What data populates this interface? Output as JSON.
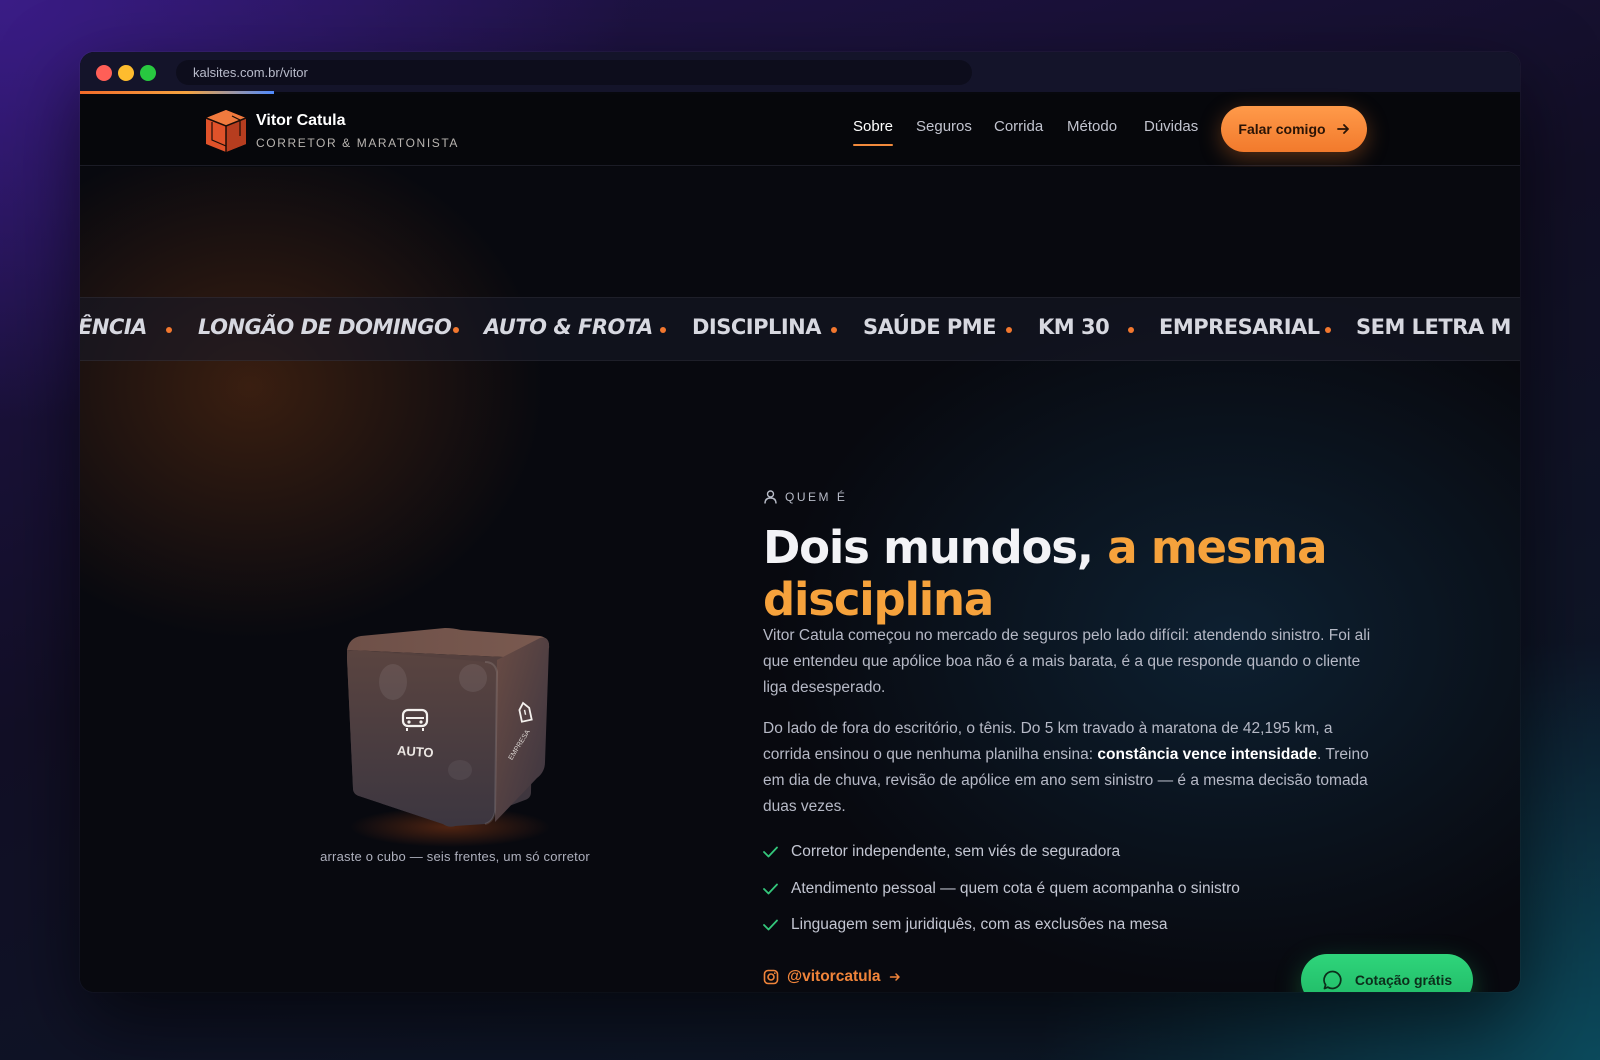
{
  "browser": {
    "url": "kalsites.com.br/vitor"
  },
  "brand": {
    "name": "Vitor Catula",
    "tagline": "CORRETOR & MARATONISTA",
    "accent": "#f27a2c"
  },
  "nav": {
    "items": [
      {
        "label": "Sobre",
        "active": true
      },
      {
        "label": "Seguros",
        "active": false
      },
      {
        "label": "Corrida",
        "active": false
      },
      {
        "label": "Método",
        "active": false
      },
      {
        "label": "Dúvidas",
        "active": false
      }
    ],
    "cta_label": "Falar comigo"
  },
  "marquee": {
    "items": [
      "ÊNCIA",
      "LONGÃO DE DOMINGO",
      "AUTO & FROTA",
      "DISCIPLINA",
      "SAÚDE PME",
      "KM 30",
      "EMPRESARIAL",
      "SEM LETRA M"
    ]
  },
  "cube": {
    "front_label": "AUTO",
    "side_label": "EMPRESA",
    "caption": "arraste o cubo — seis frentes, um só corretor"
  },
  "about": {
    "eyebrow": "QUEM É",
    "headline_plain": "Dois mundos,",
    "headline_accent_1": "a mesma",
    "headline_accent_2": "disciplina",
    "para1": "Vitor Catula começou no mercado de seguros pelo lado difícil: atendendo sinistro. Foi ali que entendeu que apólice boa não é a mais barata, é a que responde quando o cliente liga desesperado.",
    "para2_start": "Do lado de fora do escritório, o tênis. Do 5 km travado à maratona de 42,195 km, a corrida ensinou o que nenhuma planilha ensina: ",
    "para2_bold": "constância vence intensidade",
    "para2_end": ". Treino em dia de chuva, revisão de apólice em ano sem sinistro — é a mesma decisão tomada duas vezes.",
    "checks": [
      "Corretor independente, sem viés de seguradora",
      "Atendimento pessoal — quem cota é quem acompanha o sinistro",
      "Linguagem sem juridiquês, com as exclusões na mesa"
    ],
    "instagram": "@vitorcatula"
  },
  "whatsapp": {
    "label": "Cotação grátis",
    "color": "#22c26b"
  }
}
